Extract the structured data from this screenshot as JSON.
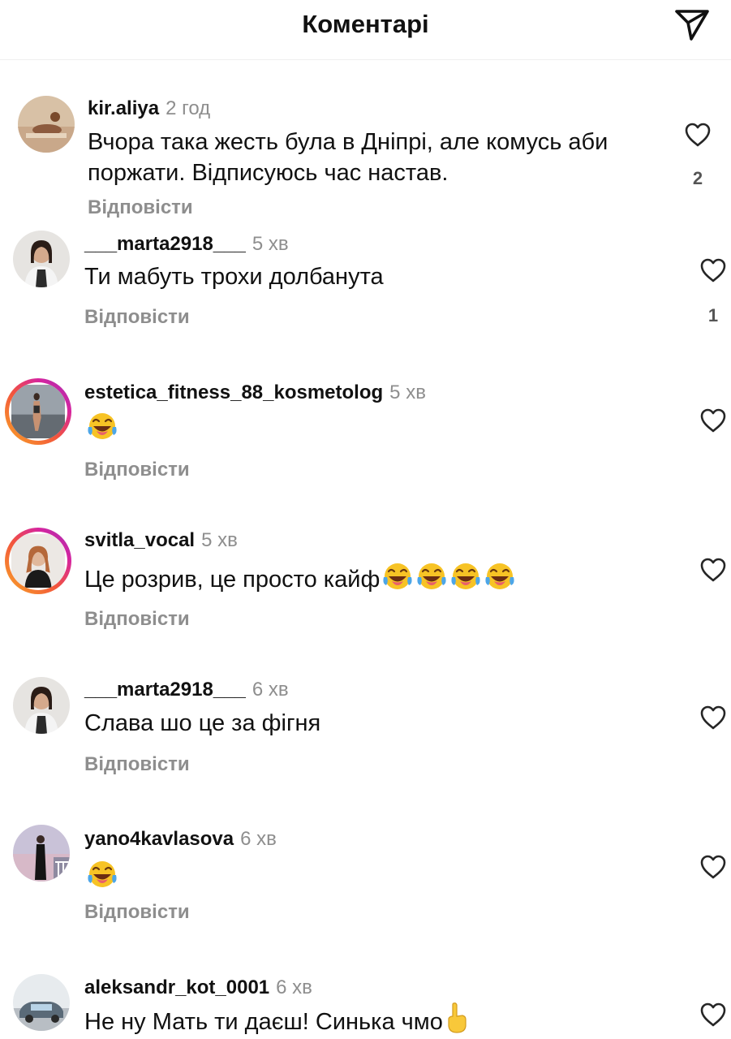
{
  "header": {
    "title": "Коментарі"
  },
  "icons": {
    "send": "send-icon",
    "like": "heart-outline-icon",
    "laugh": "face-with-tears-of-joy-emoji",
    "finger": "index-pointing-up-emoji"
  },
  "colors": {
    "muted": "#8e8e8e",
    "story_ring_start": "#f9a825",
    "story_ring_end": "#d6249f"
  },
  "comments": [
    {
      "username": "kir.aliya",
      "time": "2 год",
      "text": "Вчора така жесть була в Дніпрі, але комусь аби поржати. Відписуюсь час настав.",
      "reply": "Відповісти",
      "likes": "2"
    },
    {
      "username": "___marta2918___",
      "time": "5 хв",
      "text": "Ти мабуть трохи долбанута",
      "reply": "Відповісти",
      "likes": "1"
    },
    {
      "username": "estetica_fitness_88_kosmetolog",
      "time": "5 хв",
      "text": "",
      "reply": "Відповісти",
      "likes": ""
    },
    {
      "username": "svitla_vocal",
      "time": "5 хв",
      "text": "Це розрив, це просто кайф",
      "reply": "Відповісти",
      "likes": ""
    },
    {
      "username": "___marta2918___",
      "time": "6 хв",
      "text": "Слава шо це за фігня",
      "reply": "Відповісти",
      "likes": ""
    },
    {
      "username": "yano4kavlasova",
      "time": "6 хв",
      "text": "",
      "reply": "Відповісти",
      "likes": ""
    },
    {
      "username": "aleksandr_kot_0001",
      "time": "6 хв",
      "text": "Не ну Мать ти даєш! Синька чмо",
      "reply": "",
      "likes": ""
    }
  ]
}
